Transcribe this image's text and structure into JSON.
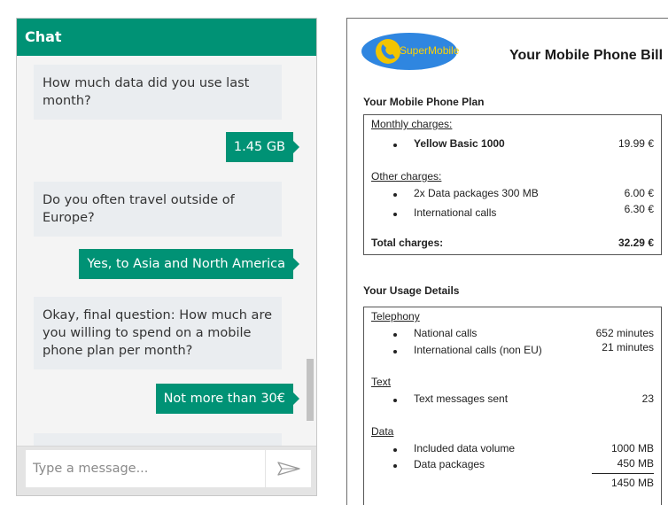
{
  "chat": {
    "header_title": "Chat",
    "messages": [
      {
        "from": "bot",
        "text": "How much data did you use last month?"
      },
      {
        "from": "user",
        "text": "1.45 GB"
      },
      {
        "from": "bot",
        "text": "Do you often travel outside of Europe?"
      },
      {
        "from": "user",
        "text": "Yes, to Asia and North America"
      },
      {
        "from": "bot",
        "text": "Okay, final question: How much are you willing to spend on a mobile phone plan per month?"
      },
      {
        "from": "user",
        "text": "Not more than 30€"
      }
    ],
    "input_placeholder": "Type a message...",
    "send_icon": "send-arrow-icon",
    "accent_color": "#009275"
  },
  "bill": {
    "logo_text": "SuperMobile",
    "logo_icon": "phone-handset-icon",
    "logo_colors": {
      "oval": "#2f86e0",
      "circle": "#f2c400"
    },
    "title": "Your Mobile Phone Bill",
    "plan": {
      "section_title": "Your Mobile Phone Plan",
      "monthly_label": "Monthly charges:",
      "monthly_items": [
        {
          "name": "Yellow Basic 1000",
          "amount": "19.99 €"
        }
      ],
      "other_label": "Other charges:",
      "other_items": [
        {
          "name": "2x Data packages 300 MB",
          "amount": "6.00 €"
        },
        {
          "name": "International calls",
          "amount": "6.30 €"
        }
      ],
      "total_label": "Total charges:",
      "total_amount": "32.29 €"
    },
    "usage": {
      "section_title": "Your Usage Details",
      "telephony_label": "Telephony",
      "telephony_items": [
        {
          "name": "National calls",
          "value": "652 minutes"
        },
        {
          "name": "International calls (non EU)",
          "value": "21 minutes"
        }
      ],
      "text_label": "Text",
      "text_items": [
        {
          "name": "Text messages sent",
          "value": "23"
        }
      ],
      "data_label": "Data",
      "data_items": [
        {
          "name": "Included data volume",
          "value": "1000 MB"
        },
        {
          "name": "Data packages",
          "value": "450 MB"
        }
      ],
      "data_total": "1450 MB"
    }
  }
}
